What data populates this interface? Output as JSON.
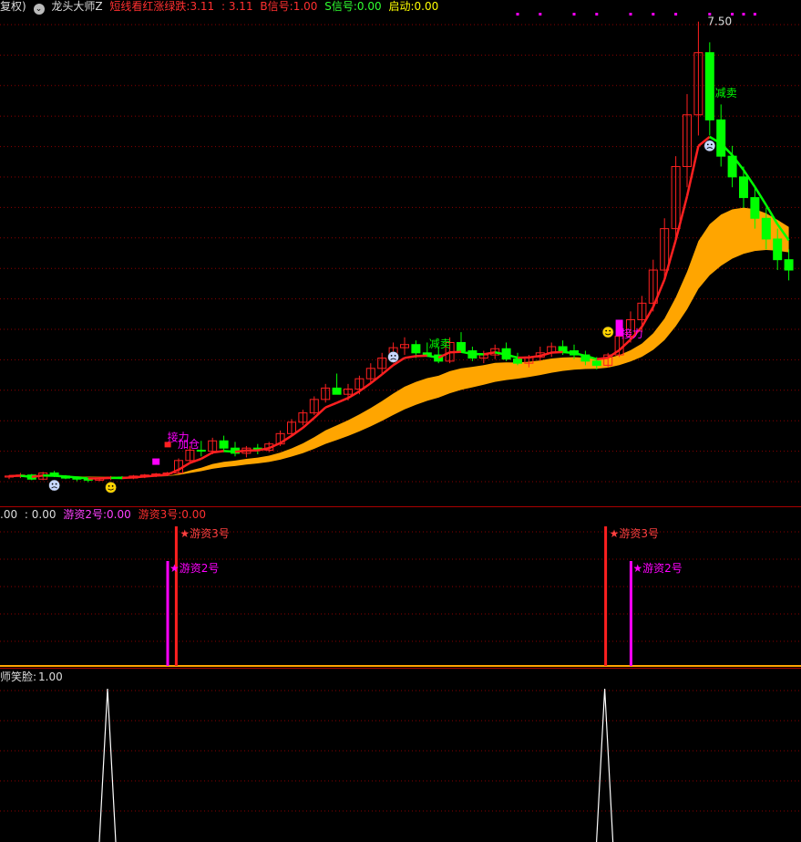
{
  "main_header": {
    "prefix": "复权)",
    "indicator_name": "龙头大师Z",
    "icon": "chevron-down-icon",
    "short_line_label": "短线看红涨绿跌:",
    "short_line_value": "3.11",
    "second_value": ": 3.11",
    "b_signal_label": "B信号:",
    "b_signal_value": "1.00",
    "s_signal_label": "S信号:",
    "s_signal_value": "0.00",
    "start_label": "启动:",
    "start_value": "0.00"
  },
  "price_annotations": {
    "high_price": "7.50",
    "labels": {
      "reduce_sell": "减卖",
      "relay": "接力",
      "add_position": "加仓"
    }
  },
  "sub_header": {
    "value1": ".00",
    "value2": ": 0.00",
    "youzi2_label": "游资2号:",
    "youzi2_value": "0.00",
    "youzi3_label": "游资3号:",
    "youzi3_value": "0.00"
  },
  "sub_signals": {
    "youzi3": "★游资3号",
    "youzi2": "★游资2号"
  },
  "smile_header": {
    "label": "师笑脸:",
    "value": "1.00"
  },
  "colors": {
    "up": "#ff2020",
    "down": "#00ff00",
    "band": "#ffa500",
    "magenta": "#ff00ff",
    "yellow": "#ffff00",
    "grid": "#8b0000"
  },
  "chart_data": [
    {
      "type": "candlestick",
      "title": "龙头大师Z",
      "ohlc": [
        [
          3.1,
          3.12,
          3.08,
          3.11
        ],
        [
          3.11,
          3.14,
          3.09,
          3.12
        ],
        [
          3.12,
          3.13,
          3.07,
          3.08
        ],
        [
          3.08,
          3.15,
          3.07,
          3.14
        ],
        [
          3.14,
          3.16,
          3.1,
          3.11
        ],
        [
          3.11,
          3.12,
          3.08,
          3.09
        ],
        [
          3.09,
          3.1,
          3.06,
          3.08
        ],
        [
          3.08,
          3.09,
          3.05,
          3.07
        ],
        [
          3.07,
          3.1,
          3.06,
          3.09
        ],
        [
          3.09,
          3.11,
          3.07,
          3.1
        ],
        [
          3.1,
          3.11,
          3.08,
          3.09
        ],
        [
          3.09,
          3.12,
          3.08,
          3.11
        ],
        [
          3.11,
          3.13,
          3.09,
          3.12
        ],
        [
          3.12,
          3.14,
          3.1,
          3.13
        ],
        [
          3.13,
          3.15,
          3.11,
          3.14
        ],
        [
          3.14,
          3.28,
          3.13,
          3.26
        ],
        [
          3.26,
          3.4,
          3.24,
          3.36
        ],
        [
          3.36,
          3.45,
          3.3,
          3.35
        ],
        [
          3.35,
          3.48,
          3.32,
          3.45
        ],
        [
          3.45,
          3.5,
          3.34,
          3.38
        ],
        [
          3.38,
          3.44,
          3.3,
          3.33
        ],
        [
          3.33,
          3.4,
          3.29,
          3.38
        ],
        [
          3.38,
          3.42,
          3.32,
          3.36
        ],
        [
          3.36,
          3.44,
          3.34,
          3.42
        ],
        [
          3.42,
          3.55,
          3.4,
          3.52
        ],
        [
          3.52,
          3.66,
          3.5,
          3.63
        ],
        [
          3.63,
          3.75,
          3.6,
          3.72
        ],
        [
          3.72,
          3.88,
          3.7,
          3.85
        ],
        [
          3.85,
          4.0,
          3.82,
          3.96
        ],
        [
          3.96,
          4.1,
          3.92,
          3.9
        ],
        [
          3.9,
          4.0,
          3.84,
          3.95
        ],
        [
          3.95,
          4.08,
          3.9,
          4.05
        ],
        [
          4.05,
          4.2,
          4.0,
          4.15
        ],
        [
          4.15,
          4.3,
          4.1,
          4.25
        ],
        [
          4.25,
          4.4,
          4.2,
          4.35
        ],
        [
          4.35,
          4.45,
          4.28,
          4.38
        ],
        [
          4.38,
          4.42,
          4.25,
          4.3
        ],
        [
          4.3,
          4.4,
          4.26,
          4.28
        ],
        [
          4.28,
          4.35,
          4.2,
          4.22
        ],
        [
          4.22,
          4.45,
          4.2,
          4.4
        ],
        [
          4.4,
          4.5,
          4.3,
          4.32
        ],
        [
          4.32,
          4.36,
          4.22,
          4.25
        ],
        [
          4.25,
          4.32,
          4.2,
          4.28
        ],
        [
          4.28,
          4.38,
          4.24,
          4.34
        ],
        [
          4.34,
          4.4,
          4.22,
          4.24
        ],
        [
          4.24,
          4.3,
          4.18,
          4.2
        ],
        [
          4.2,
          4.28,
          4.16,
          4.26
        ],
        [
          4.26,
          4.36,
          4.22,
          4.3
        ],
        [
          4.3,
          4.4,
          4.26,
          4.36
        ],
        [
          4.36,
          4.42,
          4.28,
          4.32
        ],
        [
          4.32,
          4.38,
          4.24,
          4.28
        ],
        [
          4.28,
          4.32,
          4.18,
          4.22
        ],
        [
          4.22,
          4.26,
          4.14,
          4.18
        ],
        [
          4.18,
          4.3,
          4.16,
          4.28
        ],
        [
          4.28,
          4.5,
          4.26,
          4.46
        ],
        [
          4.46,
          4.7,
          4.4,
          4.62
        ],
        [
          4.62,
          4.85,
          4.5,
          4.78
        ],
        [
          4.78,
          5.2,
          4.7,
          5.1
        ],
        [
          5.1,
          5.6,
          5.0,
          5.5
        ],
        [
          5.5,
          6.2,
          5.4,
          6.1
        ],
        [
          6.1,
          6.8,
          5.9,
          6.6
        ],
        [
          6.6,
          7.5,
          6.4,
          7.2
        ],
        [
          7.2,
          7.3,
          6.4,
          6.55
        ],
        [
          6.55,
          6.7,
          6.1,
          6.2
        ],
        [
          6.2,
          6.3,
          5.9,
          6.0
        ],
        [
          6.0,
          6.1,
          5.7,
          5.8
        ],
        [
          5.8,
          5.9,
          5.5,
          5.6
        ],
        [
          5.6,
          5.7,
          5.3,
          5.4
        ],
        [
          5.4,
          5.5,
          5.1,
          5.2
        ],
        [
          5.2,
          5.3,
          5.0,
          5.1
        ]
      ],
      "high_label": "7.50"
    },
    {
      "type": "bar",
      "title": "游资",
      "series": [
        {
          "name": "游资3号",
          "signal_bars": [
            16,
            54
          ]
        },
        {
          "name": "游资2号",
          "signal_bars": [
            15,
            56
          ]
        }
      ]
    },
    {
      "type": "line",
      "title": "师笑脸",
      "series": [
        {
          "name": "师笑脸",
          "spikes_at": [
            10,
            54
          ],
          "peak": 1.0
        }
      ]
    }
  ]
}
